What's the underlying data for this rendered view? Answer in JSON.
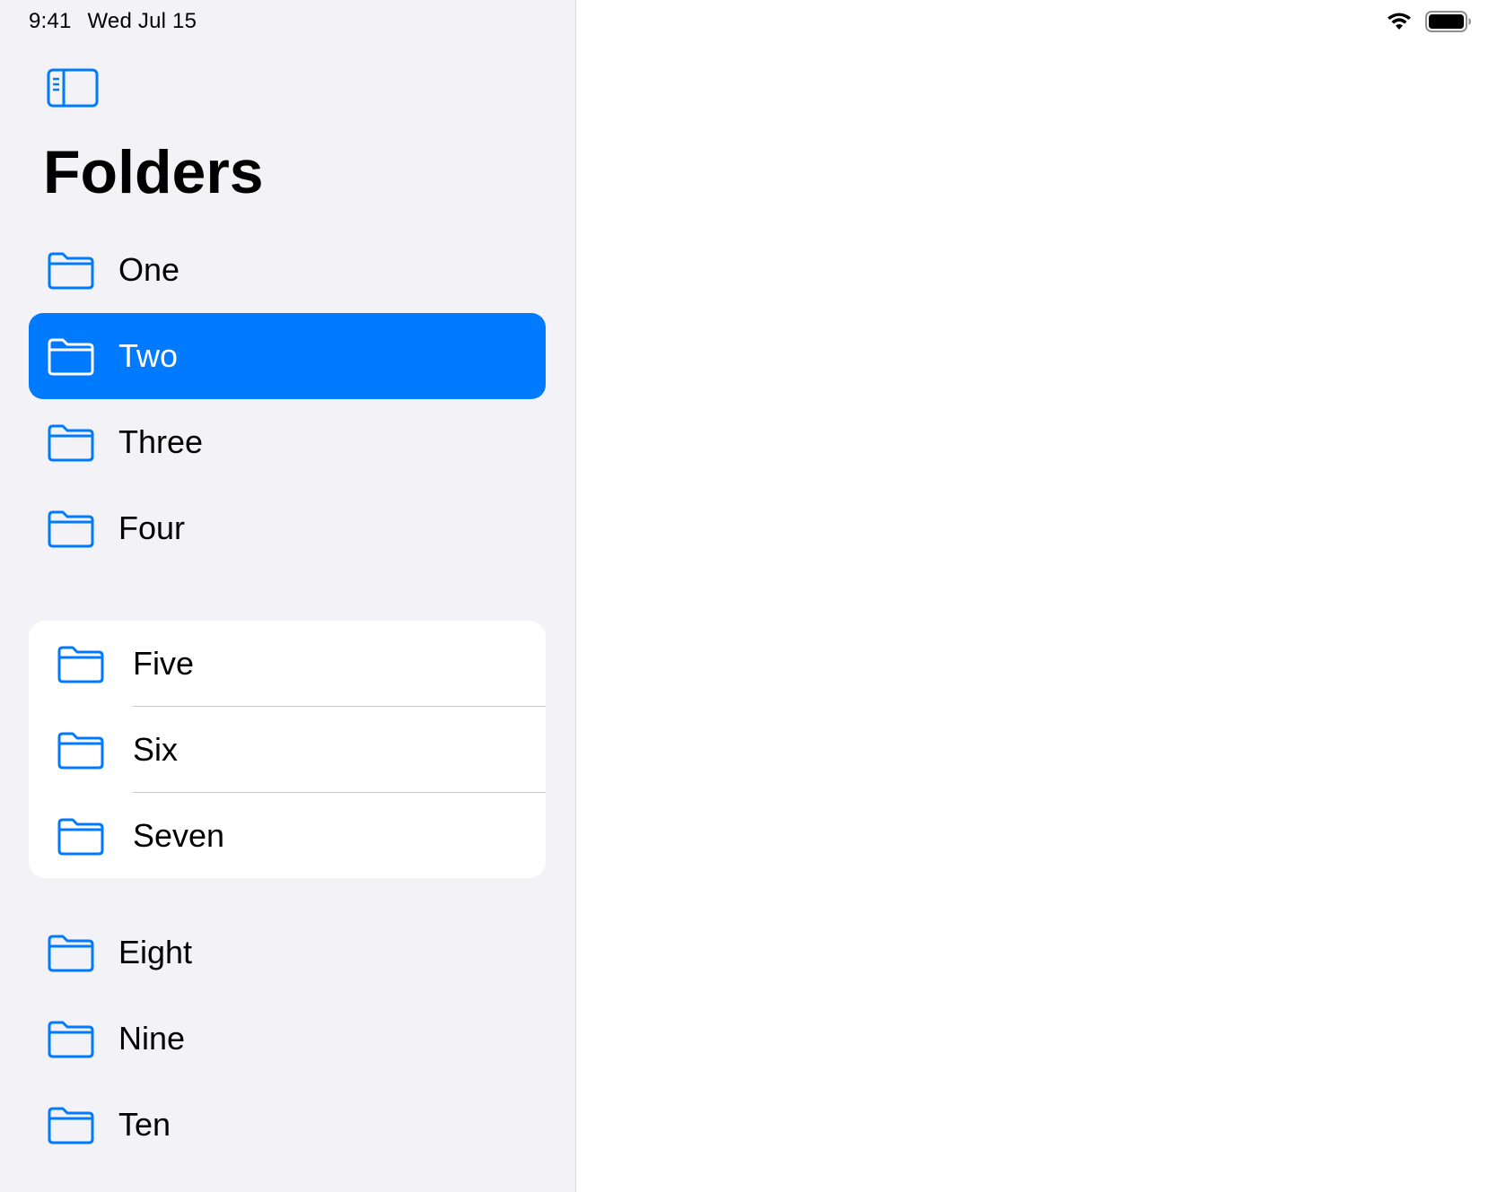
{
  "status_bar": {
    "time": "9:41",
    "date": "Wed Jul 15",
    "wifi_icon": "wifi-icon",
    "battery_icon": "battery-icon"
  },
  "sidebar": {
    "toggle_icon": "sidebar-toggle-icon",
    "title": "Folders",
    "accent_color": "#007aff",
    "items_top": [
      {
        "label": "One",
        "icon": "folder-icon",
        "selected": false
      },
      {
        "label": "Two",
        "icon": "folder-icon",
        "selected": true
      },
      {
        "label": "Three",
        "icon": "folder-icon",
        "selected": false
      },
      {
        "label": "Four",
        "icon": "folder-icon",
        "selected": false
      }
    ],
    "items_group": [
      {
        "label": "Five",
        "icon": "folder-icon"
      },
      {
        "label": "Six",
        "icon": "folder-icon"
      },
      {
        "label": "Seven",
        "icon": "folder-icon"
      }
    ],
    "items_bottom": [
      {
        "label": "Eight",
        "icon": "folder-icon"
      },
      {
        "label": "Nine",
        "icon": "folder-icon"
      },
      {
        "label": "Ten",
        "icon": "folder-icon"
      }
    ]
  }
}
